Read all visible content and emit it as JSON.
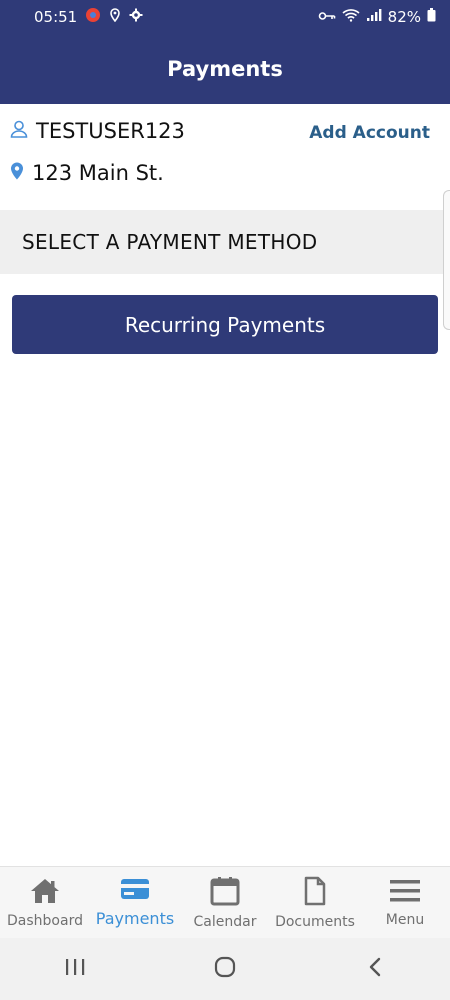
{
  "status_bar": {
    "time": "05:51",
    "battery": "82%"
  },
  "header": {
    "title": "Payments"
  },
  "account": {
    "username": "TESTUSER123",
    "address": "123 Main St.",
    "add_account_label": "Add Account"
  },
  "section": {
    "title": "SELECT A PAYMENT METHOD"
  },
  "recurring_button": {
    "label": "Recurring Payments"
  },
  "nav": {
    "items": [
      {
        "label": "Dashboard",
        "icon": "home-icon"
      },
      {
        "label": "Payments",
        "icon": "credit-card-icon",
        "active": true
      },
      {
        "label": "Calendar",
        "icon": "calendar-icon"
      },
      {
        "label": "Documents",
        "icon": "document-icon"
      },
      {
        "label": "Menu",
        "icon": "hamburger-icon"
      }
    ]
  },
  "colors": {
    "brand": "#2f3a78",
    "link": "#2b5f8a",
    "active": "#3b8fd6",
    "inactive": "#707070"
  }
}
